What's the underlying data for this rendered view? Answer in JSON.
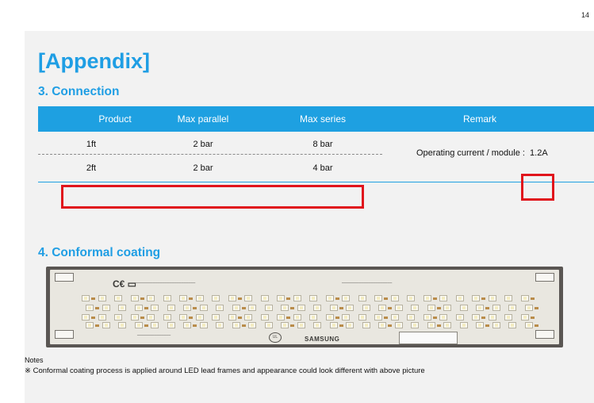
{
  "page_number": "14",
  "title": "[Appendix]",
  "connection": {
    "heading": "3. Connection",
    "headers": [
      "Product",
      "Max parallel",
      "Max series",
      "Remark"
    ],
    "rows": [
      {
        "product": "1ft",
        "max_parallel": "2 bar",
        "max_series": "8 bar"
      },
      {
        "product": "2ft",
        "max_parallel": "2 bar",
        "max_series": "4 bar"
      }
    ],
    "remark_label": "Operating current / module :",
    "remark_value": "1.2A",
    "highlight_color": "#e0141c",
    "header_color": "#1ea0e1"
  },
  "coating": {
    "heading": "4. Conformal coating",
    "photo_description_icon": "led-module-photo",
    "board_brand": "SAMSUNG"
  },
  "notes": {
    "label": "Notes",
    "line": "※  Conformal coating process is applied around LED lead frames and appearance could look different with above picture"
  },
  "accent_color": "#1f9ee4"
}
